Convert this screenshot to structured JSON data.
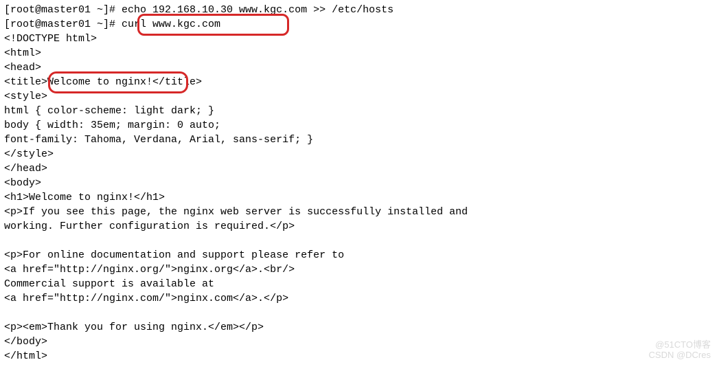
{
  "lines": {
    "l0": "[root@master01 ~]# echo 192.168.10.30 www.kgc.com >> /etc/hosts",
    "l1": "[root@master01 ~]# curl www.kgc.com",
    "l2": "<!DOCTYPE html>",
    "l3": "<html>",
    "l4": "<head>",
    "l5": "<title>Welcome to nginx!</title>",
    "l6": "<style>",
    "l7": "html { color-scheme: light dark; }",
    "l8": "body { width: 35em; margin: 0 auto;",
    "l9": "font-family: Tahoma, Verdana, Arial, sans-serif; }",
    "l10": "</style>",
    "l11": "</head>",
    "l12": "<body>",
    "l13": "<h1>Welcome to nginx!</h1>",
    "l14": "<p>If you see this page, the nginx web server is successfully installed and",
    "l15": "working. Further configuration is required.</p>",
    "l16": "",
    "l17": "<p>For online documentation and support please refer to",
    "l18": "<a href=\"http://nginx.org/\">nginx.org</a>.<br/>",
    "l19": "Commercial support is available at",
    "l20": "<a href=\"http://nginx.com/\">nginx.com</a>.</p>",
    "l21": "",
    "l22": "<p><em>Thank you for using nginx.</em></p>",
    "l23": "</body>",
    "l24": "</html>"
  },
  "highlights": {
    "h1_label": "curl-command-highlight",
    "h2_label": "title-text-highlight"
  },
  "watermark": {
    "line1": "@51CTO博客",
    "line2": "CSDN @DCres"
  }
}
